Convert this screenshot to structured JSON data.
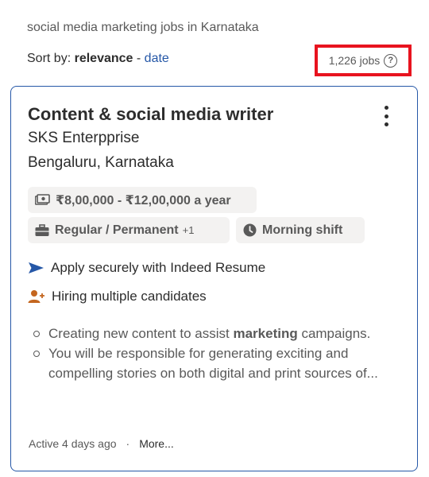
{
  "search": {
    "summary": "social media marketing jobs in Karnataka"
  },
  "sort": {
    "prefix": "Sort by:",
    "active": "relevance",
    "separator": "-",
    "alternative": "date"
  },
  "job_count": "1,226 jobs",
  "job": {
    "title": "Content & social media writer",
    "company": "SKS Enterpprise",
    "location": "Bengaluru, Karnataka",
    "salary": "₹8,00,000 - ₹12,00,000 a year",
    "job_type": "Regular / Permanent",
    "job_type_extra": "+1",
    "shift": "Morning shift",
    "features": {
      "apply": "Apply securely with Indeed Resume",
      "hiring": "Hiring multiple candidates"
    },
    "snippet": [
      {
        "before": "Creating new content to assist ",
        "bold": "marketing",
        "after": " campaigns."
      },
      {
        "before": "You will be responsible for generating exciting and compelling stories on both digital and print sources of...",
        "bold": "",
        "after": ""
      }
    ],
    "posted": "Active 4 days ago",
    "dot": "·",
    "more": "More..."
  },
  "colors": {
    "accent": "#2557a7",
    "highlight_box": "#e8131f",
    "chip_bg": "#f3f2f1",
    "icon_orange": "#c4661f"
  },
  "icons": [
    "help-icon",
    "kebab-menu-icon",
    "money-icon",
    "briefcase-icon",
    "clock-icon",
    "send-arrow-icon",
    "add-person-icon"
  ]
}
